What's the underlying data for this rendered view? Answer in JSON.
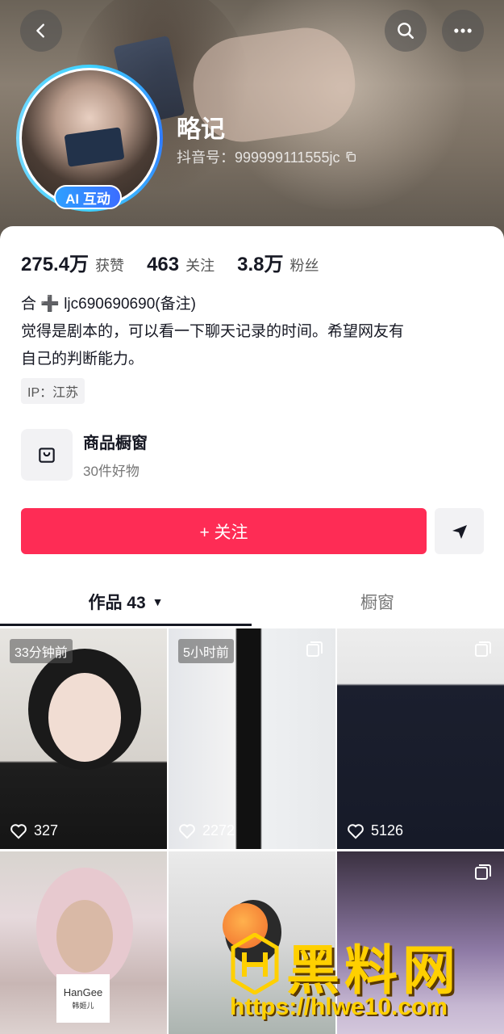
{
  "header": {
    "nickname": "略记",
    "douyin_id": "抖音号：999999111555jc",
    "ai_badge": "AI 互动",
    "icons": {
      "back": "back-arrow-icon",
      "search": "search-icon",
      "more": "more-icon",
      "copy": "copy-icon"
    }
  },
  "stats": [
    {
      "num": "275.4万",
      "label": "获赞"
    },
    {
      "num": "463",
      "label": "关注"
    },
    {
      "num": "3.8万",
      "label": "粉丝"
    }
  ],
  "bio": {
    "line1": "合 ➕ ljc690690690(备注)",
    "line2": "觉得是剧本的，可以看一下聊天记录的时间。希望网友有",
    "line3": "自己的判断能力。"
  },
  "ip_tag": "IP：江苏",
  "shop": {
    "title": "商品橱窗",
    "subtitle": "30件好物",
    "icon": "shopping-bag-icon"
  },
  "follow_button": "+ 关注",
  "share_icon": "send-icon",
  "tabs": {
    "works": "作品 43",
    "caret": "▼",
    "showcase": "橱窗"
  },
  "videos": [
    {
      "time": "33分钟前",
      "likes": "327",
      "multi": false
    },
    {
      "time": "5小时前",
      "likes": "2272",
      "multi": true
    },
    {
      "time": "",
      "likes": "5126",
      "multi": true
    },
    {
      "time": "",
      "likes": "",
      "multi": false
    },
    {
      "time": "",
      "likes": "",
      "multi": false
    },
    {
      "time": "",
      "likes": "",
      "multi": true
    }
  ],
  "hangee": {
    "brand": "HanGee",
    "sub": "韩姬儿"
  },
  "watermark": {
    "title": "黑料网",
    "url": "https://hlwe10.com"
  },
  "colors": {
    "accent": "#fe2c55",
    "text": "#161823",
    "ai_badge": "#2f7bff",
    "watermark": "#ffd000"
  }
}
